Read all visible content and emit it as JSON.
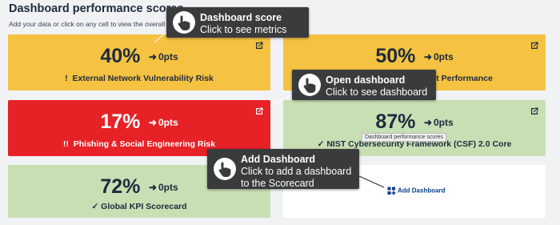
{
  "header": {
    "title": "Dashboard performance scores",
    "subtitle": "Add your data or click on any cell to view the overall control"
  },
  "cards": [
    {
      "pct": "40%",
      "pts": "0pts",
      "prefix": "!",
      "name": "External Network Vulnerability Risk",
      "status": "yellow"
    },
    {
      "pct": "50%",
      "pts": "0pts",
      "prefix": "",
      "name": "Asset Performance",
      "status": "yellow"
    },
    {
      "pct": "17%",
      "pts": "0pts",
      "prefix": "!!",
      "name": "Phishing & Social Engineering Risk",
      "status": "red"
    },
    {
      "pct": "87%",
      "pts": "0pts",
      "prefix": "✓",
      "name": "NIST Cybersecurity Framework (CSF) 2.0 Core",
      "status": "green"
    },
    {
      "pct": "72%",
      "pts": "0pts",
      "prefix": "✓",
      "name": "Global KPI Scorecard",
      "status": "green"
    }
  ],
  "add_dashboard": {
    "label": "Add Dashboard"
  },
  "tooltips": {
    "score": {
      "title": "Dashboard score",
      "desc": "Click to see metrics"
    },
    "open": {
      "title": "Open dashboard",
      "desc": "Click to see dashboard"
    },
    "add": {
      "title": "Add Dashboard",
      "desc1": "Click to add a dashboard",
      "desc2": "to the Scorecard"
    }
  },
  "hover_tip": "Dashboard performance scores",
  "colors": {
    "yellow": "#f5c242",
    "red": "#e62227",
    "green": "#c8dfb4",
    "text": "#1e2b3d",
    "link": "#0b3f86"
  }
}
